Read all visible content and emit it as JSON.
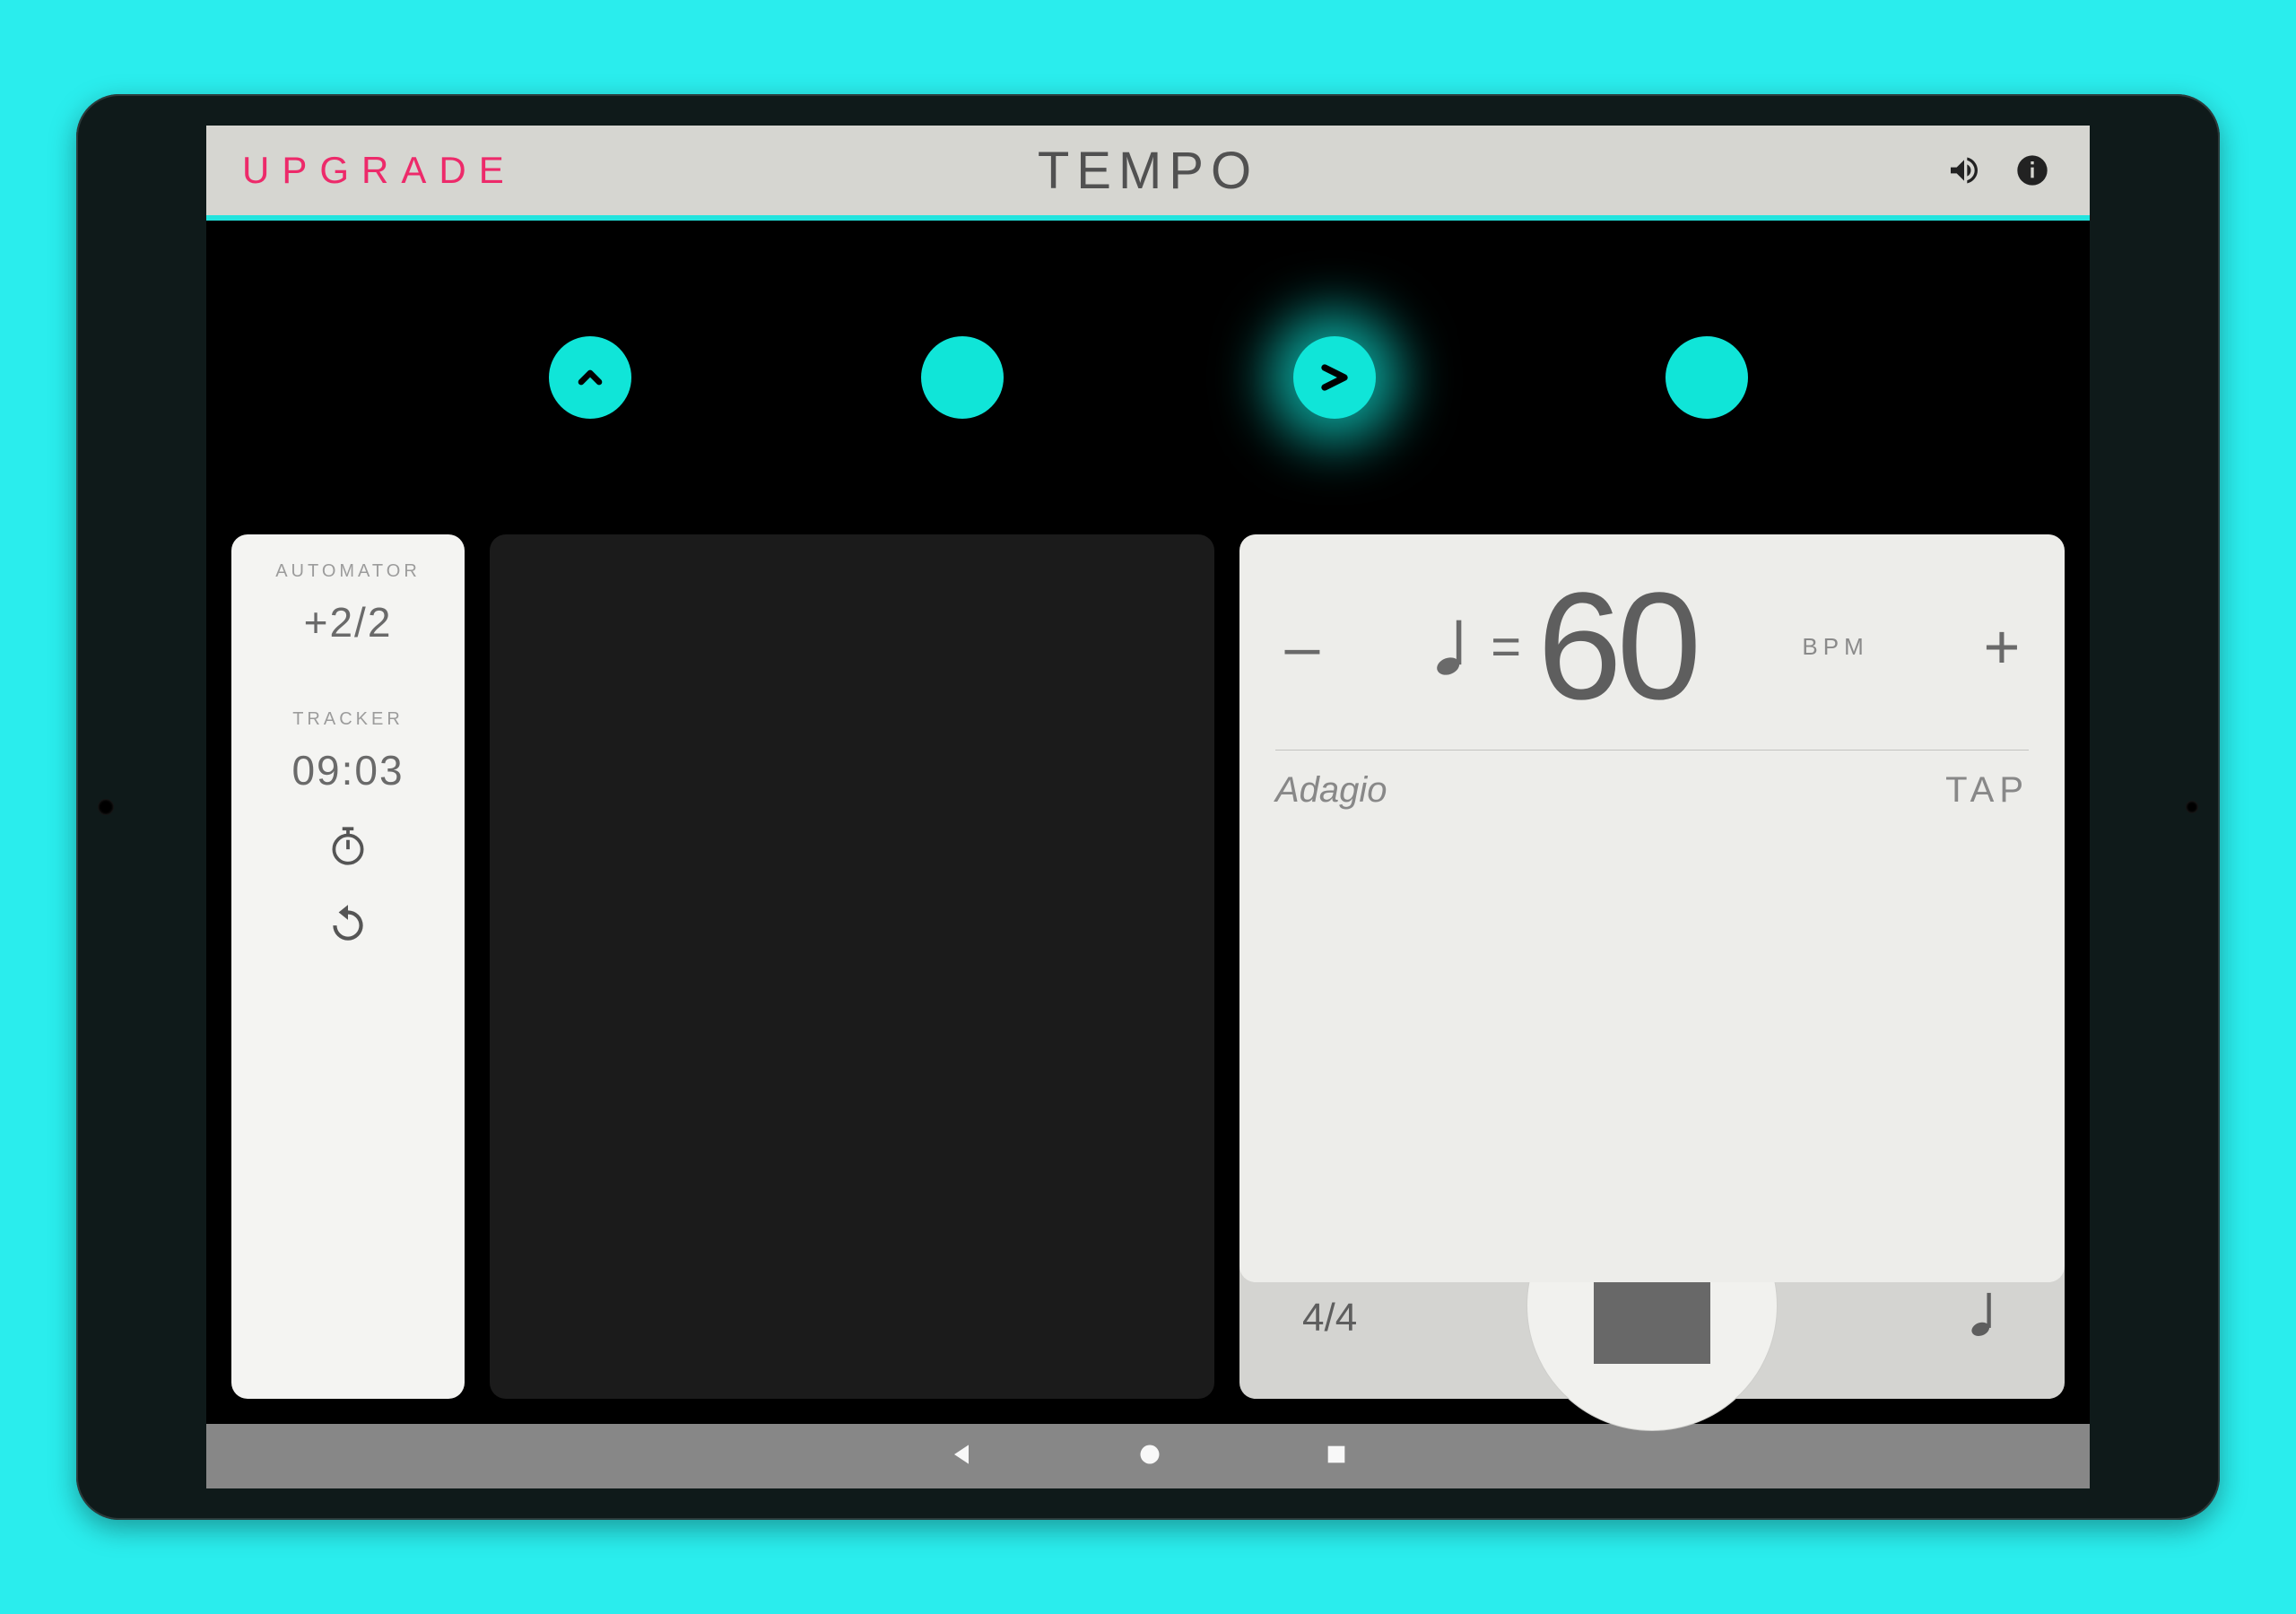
{
  "header": {
    "upgrade_label": "UPGRADE",
    "title": "TEMPO"
  },
  "beats": {
    "count": 4,
    "active_index": 2,
    "types": [
      "accent",
      "plain",
      "accent-arrow",
      "plain"
    ]
  },
  "sidebar": {
    "automator_label": "AUTOMATOR",
    "automator_value": "+2/2",
    "tracker_label": "TRACKER",
    "tracker_value": "09:03"
  },
  "bpm": {
    "minus": "–",
    "plus": "+",
    "equals": "=",
    "value": "60",
    "unit": "BPM",
    "tempo_name": "Adagio",
    "tap_label": "TAP"
  },
  "bottom": {
    "time_signature": "4/4"
  },
  "colors": {
    "accent": "#10E5D8",
    "bg": "#2AEDED",
    "pink": "#ed2a6a"
  }
}
